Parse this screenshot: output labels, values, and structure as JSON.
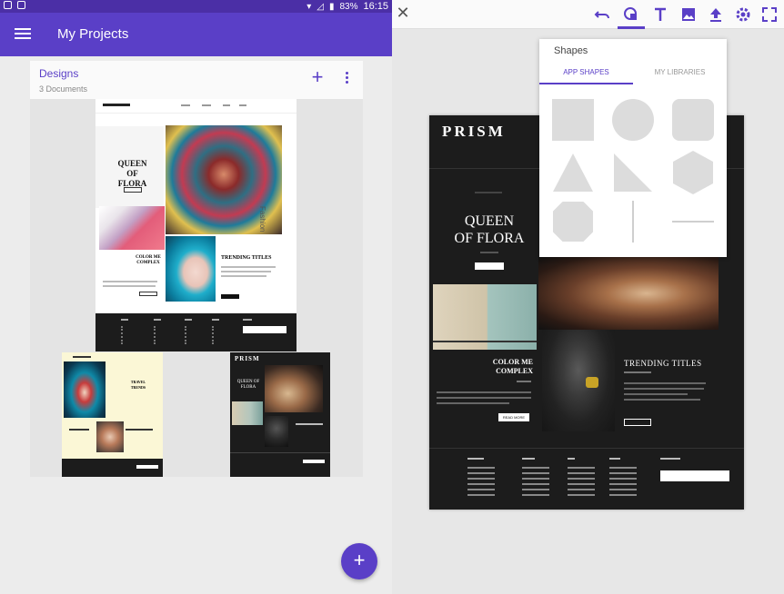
{
  "status_bar": {
    "battery": "83%",
    "time": "16:15"
  },
  "app_bar": {
    "title": "My Projects"
  },
  "designs_card": {
    "title": "Designs",
    "subtitle": "3 Documents"
  },
  "thumbnails": {
    "doc1": {
      "headline": "QUEEN OF FLORA",
      "feature2": "COLOR ME COMPLEX",
      "feature3": "TRENDING TITLES",
      "side_label": "Fashion"
    },
    "doc2": {
      "headline": "TRAVEL TRENDS"
    },
    "doc3": {
      "brand": "PRISM",
      "headline": "QUEEN OF FLORA"
    }
  },
  "editor": {
    "popup": {
      "title": "Shapes",
      "tabs": [
        "APP SHAPES",
        "MY LIBRARIES"
      ]
    },
    "canvas": {
      "brand": "PRISM",
      "headline_line1": "QUEEN",
      "headline_line2": "OF FLORA",
      "feature1_line1": "COLOR ME",
      "feature1_line2": "COMPLEX",
      "feature2": "TRENDING TITLES",
      "button_label": "READ MORE"
    }
  },
  "colors": {
    "primary": "#5a3fc7",
    "status": "#4b2fa6",
    "dark": "#1c1c1c"
  }
}
